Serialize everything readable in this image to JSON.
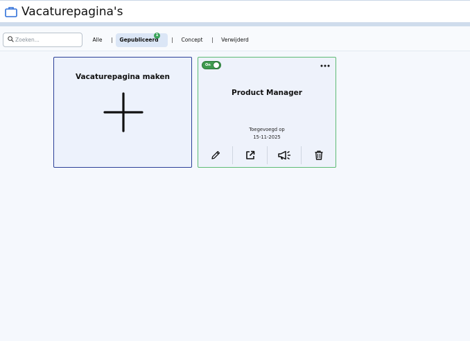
{
  "header": {
    "title": "Vacaturepagina's",
    "icon": "briefcase-icon"
  },
  "search": {
    "placeholder": "Zoeken..."
  },
  "tabs": [
    {
      "label": "Alle"
    },
    {
      "label": "Gepubliceerd",
      "badge": "1",
      "active": true
    },
    {
      "label": "Concept"
    },
    {
      "label": "Verwijderd"
    }
  ],
  "separator": "|",
  "create_card": {
    "title": "Vacaturepagina maken"
  },
  "job_card": {
    "toggle_label": "On",
    "title": "Product Manager",
    "added_label": "Toegevoegd op",
    "added_date": "15-11-2025",
    "actions": [
      "pencil-icon",
      "external-link-icon",
      "megaphone-icon",
      "trash-icon"
    ]
  },
  "colors": {
    "accent": "#2a3f97",
    "published": "#3f9a4f",
    "active_tab": "#dbe6f6"
  }
}
